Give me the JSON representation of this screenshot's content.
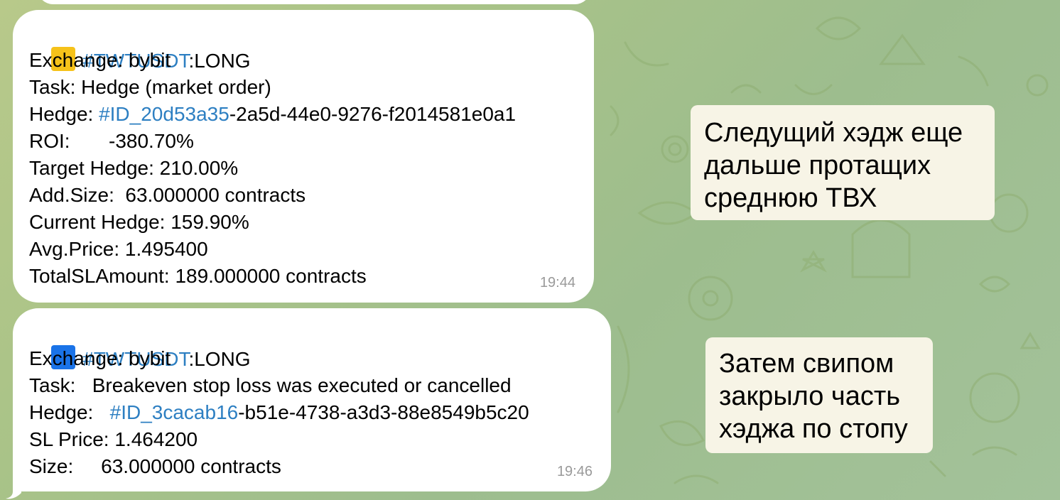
{
  "messages": [
    {
      "square_color": "#f6c21a",
      "lines": {
        "header_tag": "#TWTUSDT",
        "header_side": ":LONG",
        "exchange": "Exchange: bybit",
        "task": "Task: Hedge (market order)",
        "hedge_label": "Hedge: ",
        "hedge_tag": "#ID_20d53a35",
        "hedge_rest": "-2a5d-44e0-9276-f2014581e0a1",
        "roi": "ROI:       -380.70%",
        "target_hedge": "Target Hedge: 210.00%",
        "add_size": "Add.Size:  63.000000 contracts",
        "current_hedge": "Current Hedge: 159.90%",
        "avg_price": "Avg.Price: 1.495400",
        "total_sl": "TotalSLAmount: 189.000000 contracts"
      },
      "time": "19:44"
    },
    {
      "square_color": "#1a73e8",
      "lines": {
        "header_tag": "#TWTUSDT",
        "header_side": ":LONG",
        "exchange": "Exchange: bybit",
        "task": "Task:   Breakeven stop loss was executed or cancelled",
        "hedge_label": "Hedge:   ",
        "hedge_tag": "#ID_3cacab16",
        "hedge_rest": "-b51e-4738-a3d3-88e8549b5c20",
        "sl_price": "SL Price: 1.464200",
        "size": "Size:     63.000000 contracts"
      },
      "time": "19:46"
    }
  ],
  "notes": [
    "Следущий хэдж еще\nдальше протащих\nсреднюю ТВХ",
    "Затем свипом\nзакрыло часть\nхэджа по стопу"
  ],
  "colors": {
    "hashtag": "#2d7fc2",
    "note_bg": "#f7f4e6"
  }
}
